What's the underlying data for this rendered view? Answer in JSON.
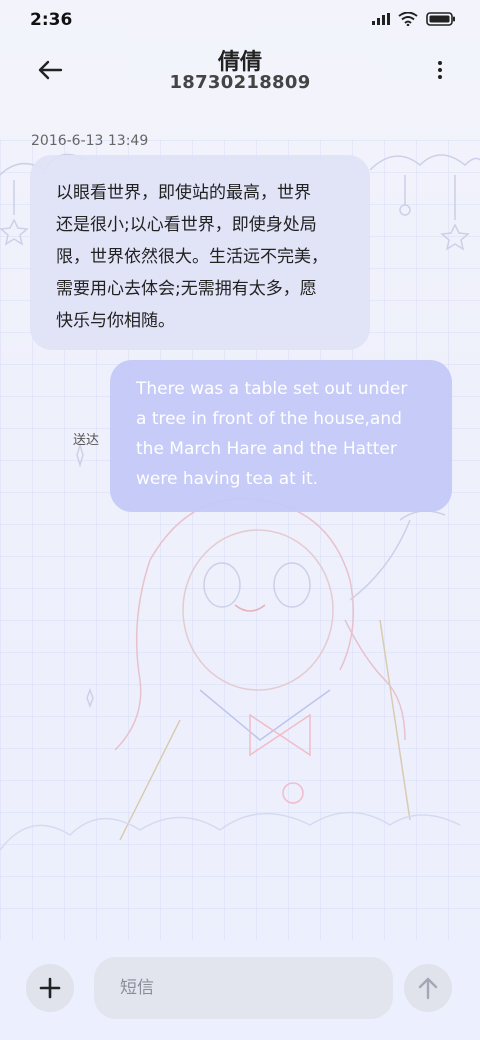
{
  "status_bar": {
    "time": "2:36",
    "icons": [
      "signal-icon",
      "wifi-icon",
      "battery-icon"
    ]
  },
  "header": {
    "contact_name": "倩倩",
    "phone_number": "18730218809",
    "back_icon": "arrow-left-icon",
    "more_icon": "more-vertical-icon"
  },
  "conversation": {
    "timestamp": "2016-6-13 13:49",
    "incoming": {
      "lines": [
        "以眼看世界，即使站的最高，世界",
        "还是很小;以心看世界，即使身处局",
        "限，世界依然很大。生活远不完美，",
        "需要用心去体会;无需拥有太多，愿",
        "快乐与你相随。"
      ]
    },
    "outgoing": {
      "lines": [
        "There was a table set out under",
        "a tree in front of the house,and",
        "the March Hare and the Hatter",
        "were having tea at it."
      ],
      "status": "送达"
    }
  },
  "composer": {
    "placeholder": "短信",
    "add_icon": "plus-icon",
    "send_icon": "arrow-up-icon"
  },
  "colors": {
    "incoming_bubble": "#e0e2f6",
    "outgoing_bubble": "#c4c8f8",
    "background": "#eef0fb"
  }
}
